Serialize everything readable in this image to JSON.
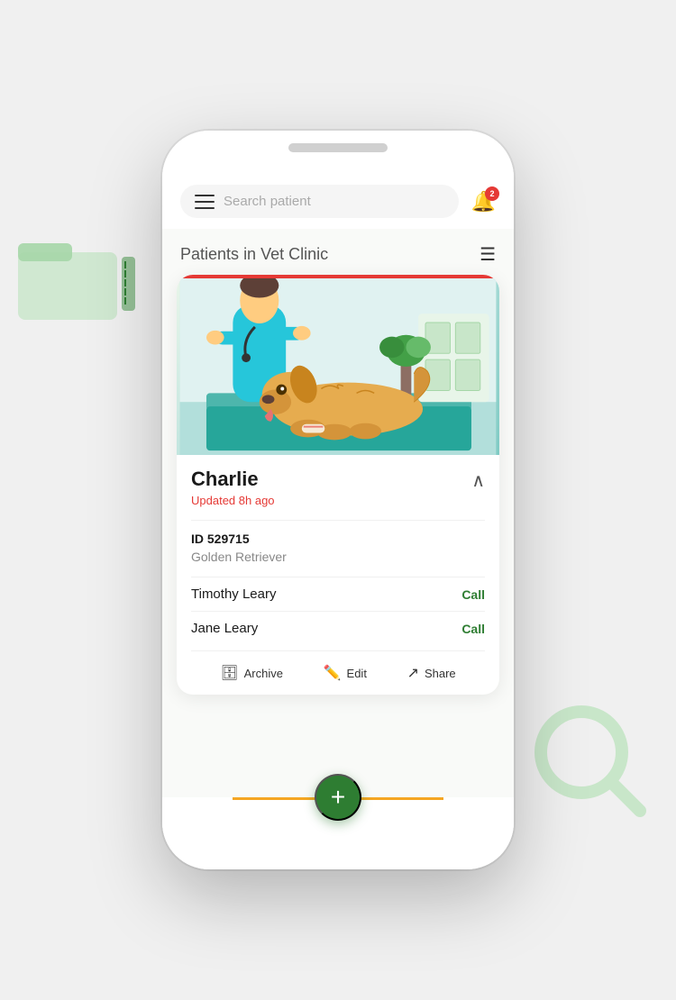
{
  "background": {
    "color": "#f0f0f0"
  },
  "search": {
    "placeholder": "Search patient",
    "badge_count": "2"
  },
  "header": {
    "title": "Patients",
    "subtitle": "in Vet Clinic"
  },
  "card": {
    "image_alt": "Dog at vet clinic",
    "pet_name": "Charlie",
    "updated": "Updated 8h ago",
    "id_label": "ID 529715",
    "breed": "Golden Retriever",
    "owners": [
      {
        "name": "Timothy Leary",
        "action": "Call"
      },
      {
        "name": "Jane Leary",
        "action": "Call"
      }
    ],
    "actions": [
      {
        "label": "Archive",
        "icon": "🗄"
      },
      {
        "label": "Edit",
        "icon": "✏️"
      },
      {
        "label": "Share",
        "icon": "↗"
      }
    ]
  },
  "fab": {
    "label": "+"
  },
  "colors": {
    "accent_green": "#2e7d32",
    "accent_red": "#e53935",
    "accent_orange": "#f5a623",
    "call_green": "#388e3c"
  }
}
